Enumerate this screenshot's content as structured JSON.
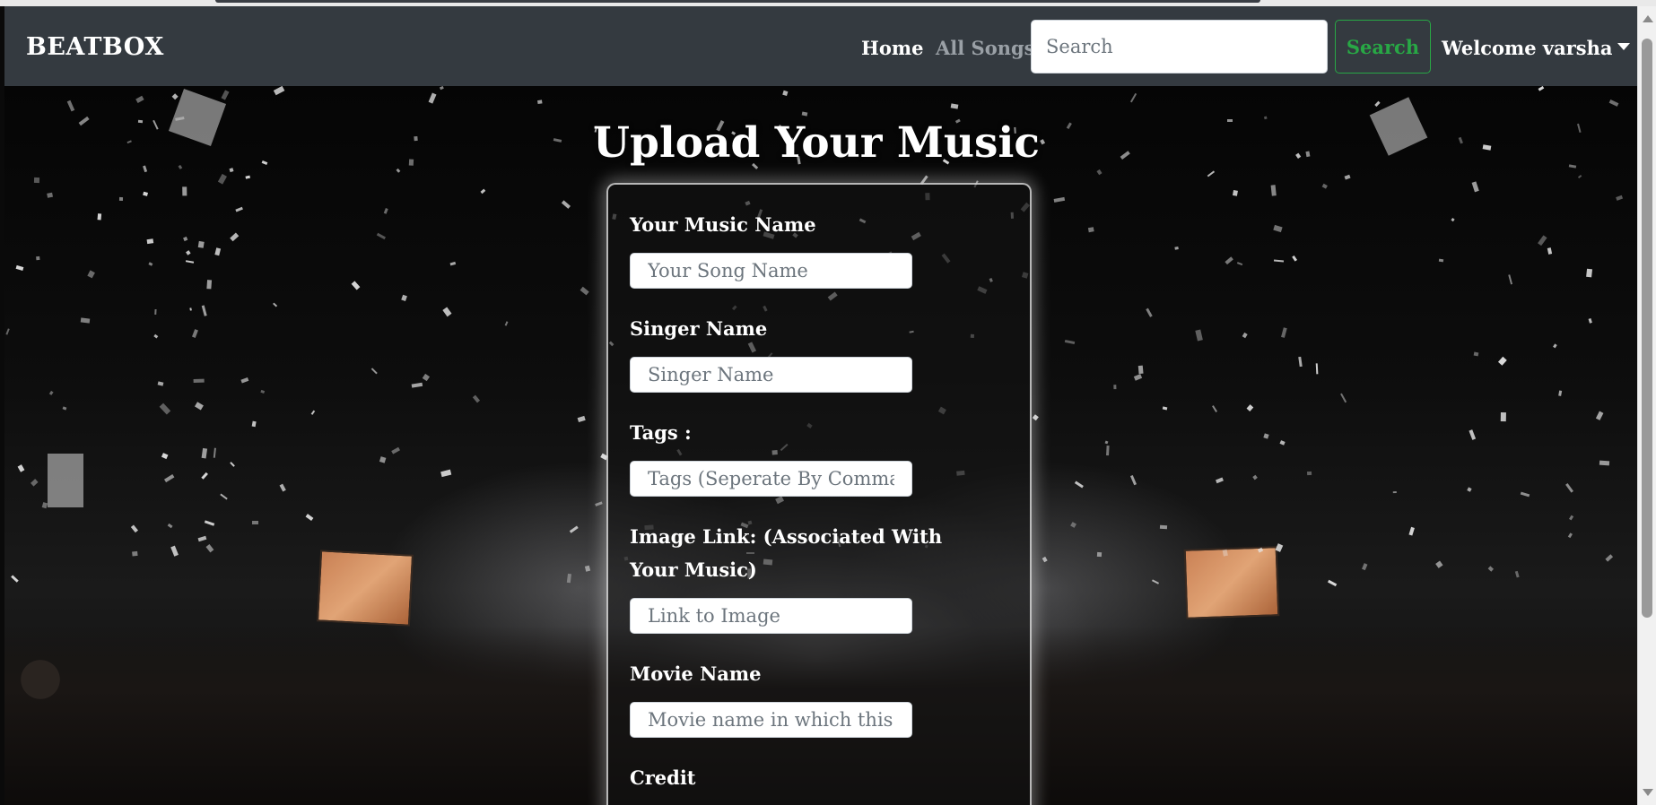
{
  "navbar": {
    "brand": "BEATBOX",
    "links": [
      {
        "label": "Home"
      },
      {
        "label": "All Songs"
      }
    ],
    "search": {
      "placeholder": "Search",
      "value": "",
      "button_label": "Search"
    },
    "user_menu": {
      "label": "Welcome varsha"
    }
  },
  "main": {
    "title": "Upload Your Music",
    "form": {
      "fields": [
        {
          "label": "Your Music Name",
          "placeholder": "Your Song Name",
          "value": ""
        },
        {
          "label": "Singer Name",
          "placeholder": "Singer Name",
          "value": ""
        },
        {
          "label": "Tags :",
          "placeholder": "Tags (Seperate By Commas)",
          "value": ""
        },
        {
          "label": "Image Link: (Associated With Your Music)",
          "placeholder": "Link to Image",
          "value": ""
        },
        {
          "label": "Movie Name",
          "placeholder": "Movie name in which this song is",
          "value": ""
        },
        {
          "label": "Credit",
          "placeholder": "",
          "value": ""
        }
      ]
    }
  },
  "colors": {
    "navbar_bg": "#343a40",
    "search_button": "#28a745",
    "inactive_link": "#9aa0a6"
  }
}
